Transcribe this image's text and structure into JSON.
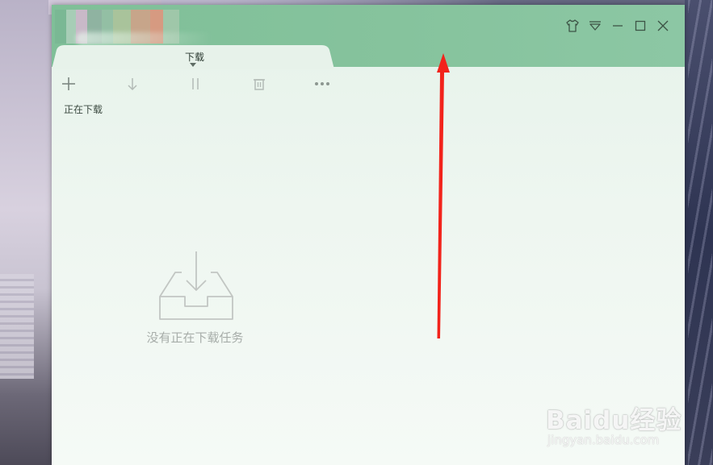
{
  "app": {
    "tab_label": "下载",
    "section_label": "正在下载",
    "empty_message": "没有正在下载任务"
  },
  "toolbar": {
    "items": [
      {
        "name": "new-task",
        "icon": "plus-icon"
      },
      {
        "name": "start",
        "icon": "download-arrow-icon"
      },
      {
        "name": "pause",
        "icon": "pause-icon"
      },
      {
        "name": "delete",
        "icon": "trash-icon"
      },
      {
        "name": "more",
        "icon": "more-dots-icon"
      }
    ]
  },
  "window_controls": [
    {
      "name": "skin",
      "icon": "tshirt-icon"
    },
    {
      "name": "menu",
      "icon": "dropdown-triangle-icon"
    },
    {
      "name": "minimize",
      "icon": "minimize-icon"
    },
    {
      "name": "maximize",
      "icon": "maximize-icon"
    },
    {
      "name": "close",
      "icon": "close-icon"
    }
  ],
  "watermark": {
    "brand": "Baidu经验",
    "url": "jingyan.baidu.com"
  },
  "colors": {
    "titlebar": "#86c39d",
    "content_bg": "#eef6f0",
    "annotation_arrow": "#f2231b",
    "icon_gray": "#a9b2ac"
  }
}
